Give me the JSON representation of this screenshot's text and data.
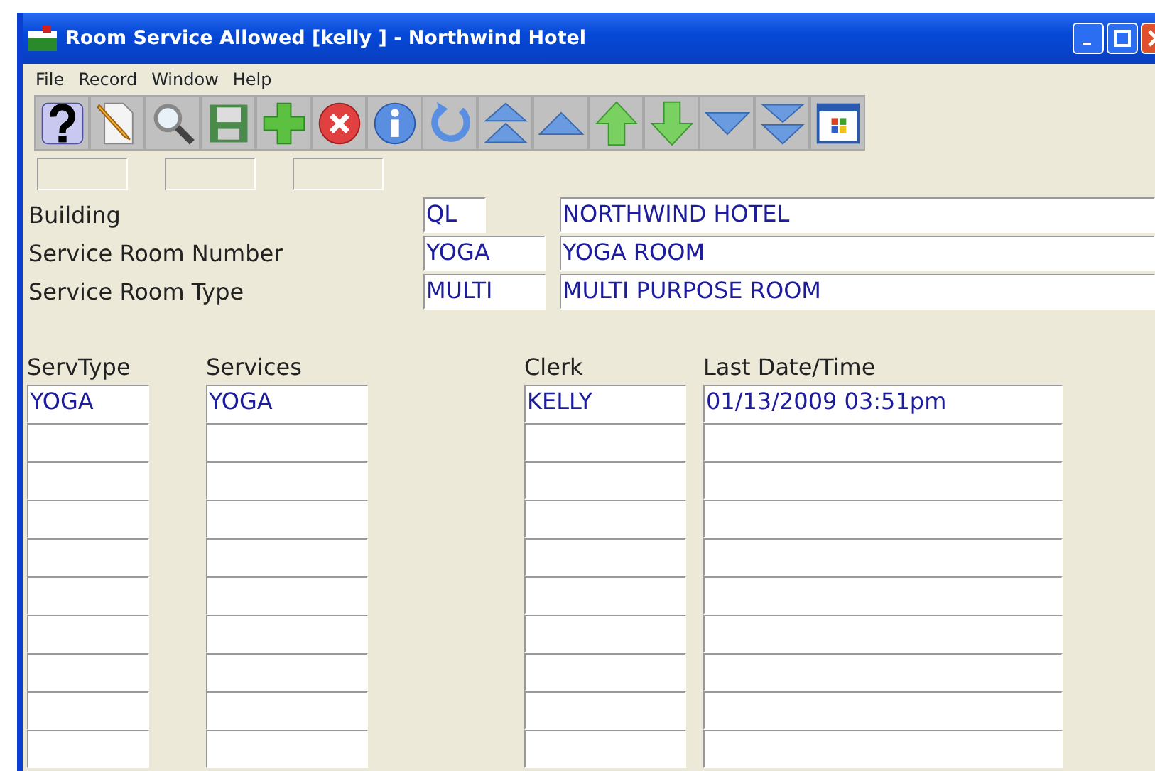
{
  "window": {
    "title": "Room Service Allowed [kelly   ] - Northwind Hotel"
  },
  "menu": [
    "File",
    "Record",
    "Window",
    "Help"
  ],
  "header_fields": [
    {
      "label": "Building",
      "code": "QL",
      "description": "NORTHWIND HOTEL",
      "narrow": true
    },
    {
      "label": "Service Room Number",
      "code": "YOGA",
      "description": "YOGA ROOM",
      "narrow": false
    },
    {
      "label": "Service Room Type",
      "code": "MULTI",
      "description": "MULTI PURPOSE ROOM",
      "narrow": false
    }
  ],
  "table": {
    "columns": [
      "ServType",
      "Services",
      "Clerk",
      "Last Date/Time"
    ],
    "rows": [
      {
        "servtype": "YOGA",
        "services": "YOGA",
        "clerk": "KELLY",
        "last_date_time": "01/13/2009 03:51pm"
      },
      {},
      {},
      {},
      {},
      {},
      {},
      {},
      {},
      {}
    ]
  }
}
